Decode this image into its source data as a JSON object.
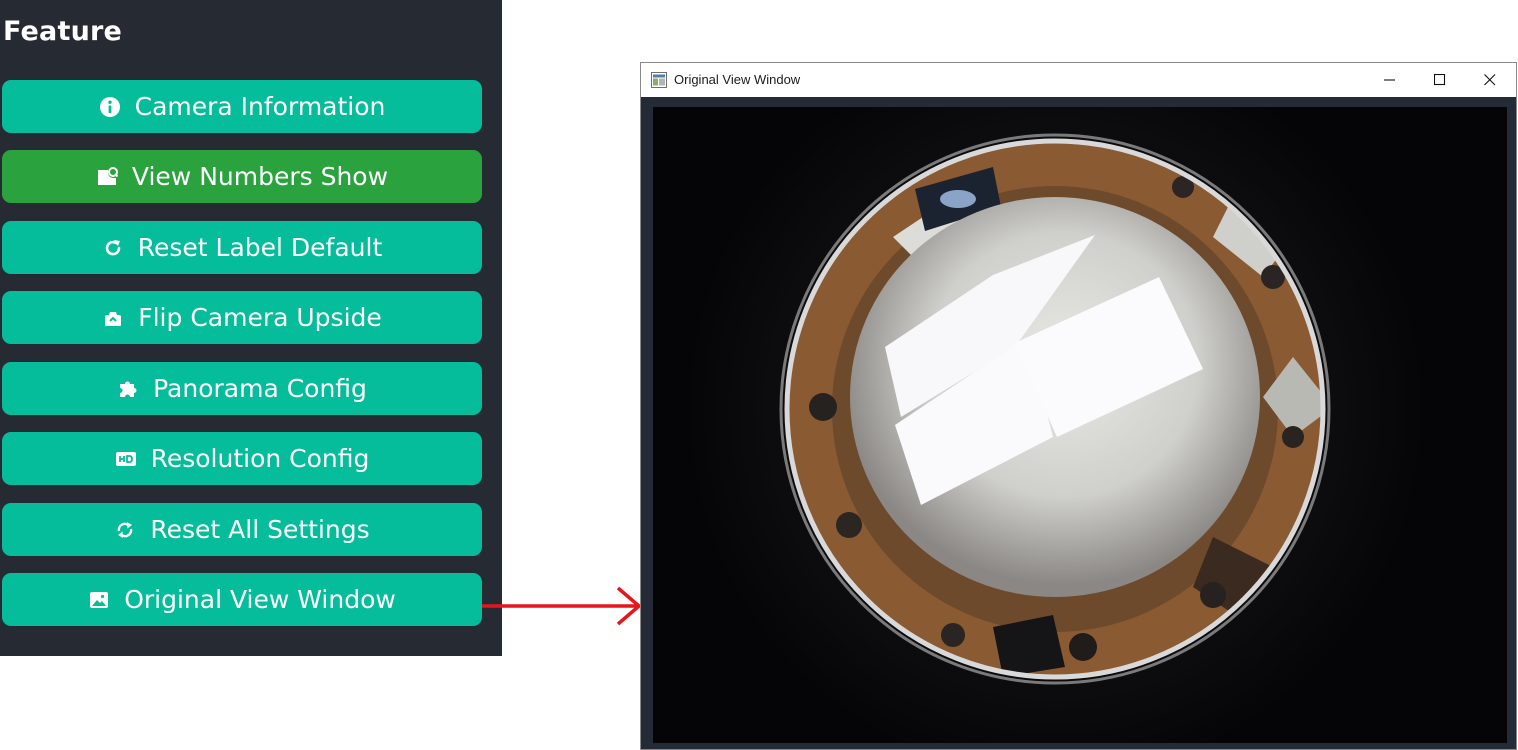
{
  "panel": {
    "title": "Feature",
    "buttons": [
      {
        "label": "Camera Information",
        "icon": "info-circle-icon"
      },
      {
        "label": "View Numbers Show",
        "icon": "label-tag-icon",
        "active": true
      },
      {
        "label": "Reset Label Default",
        "icon": "refresh-icon"
      },
      {
        "label": "Flip Camera Upside",
        "icon": "camera-flip-icon"
      },
      {
        "label": "Panorama Config",
        "icon": "puzzle-icon"
      },
      {
        "label": "Resolution Config",
        "icon": "hd-icon"
      },
      {
        "label": "Reset All Settings",
        "icon": "sync-icon"
      },
      {
        "label": "Original View Window",
        "icon": "image-icon"
      }
    ]
  },
  "window": {
    "title": "Original View Window",
    "controls": [
      "minimize-icon",
      "maximize-icon",
      "close-icon"
    ]
  },
  "colors": {
    "panel_bg": "#262a33",
    "button_teal": "#05bd9a",
    "button_active_green": "#2aa33f",
    "arrow_red": "#e8141c",
    "viewport_bg": "#242a36"
  }
}
